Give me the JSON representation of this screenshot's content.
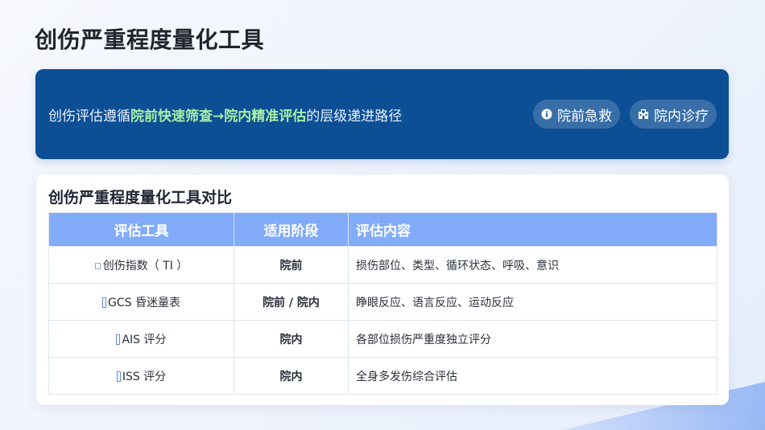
{
  "page": {
    "title": "创伤严重程度量化工具"
  },
  "banner": {
    "text_before": "创伤评估遵循",
    "text_highlight": "院前快速筛查→院内精准评估",
    "text_after": "的层级递进路径",
    "pills": [
      {
        "icon": "info-circle-icon",
        "label": "院前急救"
      },
      {
        "icon": "hospital-icon",
        "label": "院内诊疗"
      }
    ]
  },
  "comparison": {
    "title": "创伤严重程度量化工具对比",
    "headers": [
      "评估工具",
      "适用阶段",
      "评估内容"
    ],
    "rows": [
      {
        "tool": "创伤指数（ TI ）",
        "stage": "院前",
        "content": "损伤部位、类型、循环状态、呼吸、意识"
      },
      {
        "tool": "GCS 昏迷量表",
        "stage": "院前 / 院内",
        "content": "睁眼反应、语言反应、运动反应"
      },
      {
        "tool": "AIS 评分",
        "stage": "院内",
        "content": "各部位损伤严重度独立评分"
      },
      {
        "tool": "ISS 评分",
        "stage": "院内",
        "content": "全身多发伤综合评估"
      }
    ]
  },
  "colors": {
    "banner_bg": "#0d4f95",
    "highlight": "#a8f0a6",
    "table_header": "#82abfa"
  }
}
